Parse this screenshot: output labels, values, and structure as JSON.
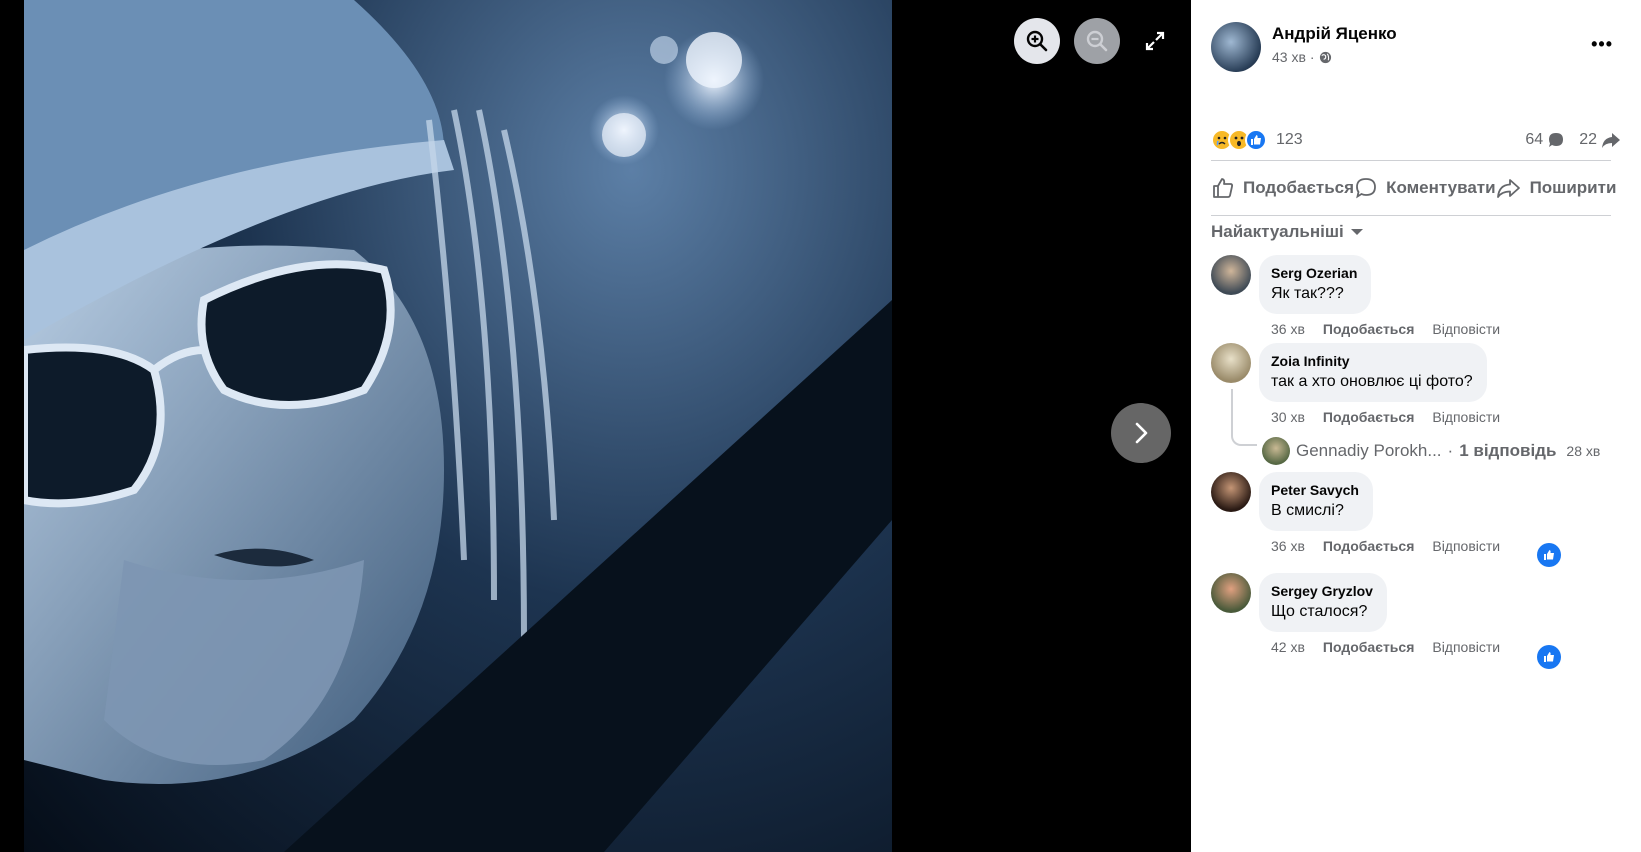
{
  "viewer": {
    "zoom_in_icon": "zoom-in-icon",
    "zoom_out_icon": "zoom-out-icon",
    "fullscreen_icon": "expand-icon",
    "next_icon": "chevron-right-icon"
  },
  "post": {
    "author": "Андрій Яценко",
    "time": "43 хв",
    "privacy_icon": "globe-icon",
    "more_label": "•••",
    "reaction_count": "123",
    "comment_count": "64",
    "share_count": "22"
  },
  "actions": {
    "like": "Подобається",
    "comment": "Коментувати",
    "share": "Поширити"
  },
  "sort_label": "Найактуальніші",
  "comments": [
    {
      "name": "Serg Ozerian",
      "text": "Як так???",
      "time": "36 хв",
      "like": "Подобається",
      "reply": "Відповісти"
    },
    {
      "name": "Zoia Infinity",
      "text": "так а хто оновлює ці фото?",
      "time": "30 хв",
      "like": "Подобається",
      "reply": "Відповісти"
    },
    {
      "name": "Peter Savych",
      "text": "В смислі?",
      "time": "36 хв",
      "like": "Подобається",
      "reply": "Відповісти"
    },
    {
      "name": "Sergey Gryzlov",
      "text": "Що сталося?",
      "time": "42 хв",
      "like": "Подобається",
      "reply": "Відповісти"
    }
  ],
  "reply_preview": {
    "name": "Gennadiy Porokh...",
    "separator": "·",
    "count": "1 відповідь",
    "time": "28 хв"
  },
  "colors": {
    "accent": "#1877f2",
    "secondary_text": "#65676b",
    "bubble": "#f0f2f5"
  }
}
